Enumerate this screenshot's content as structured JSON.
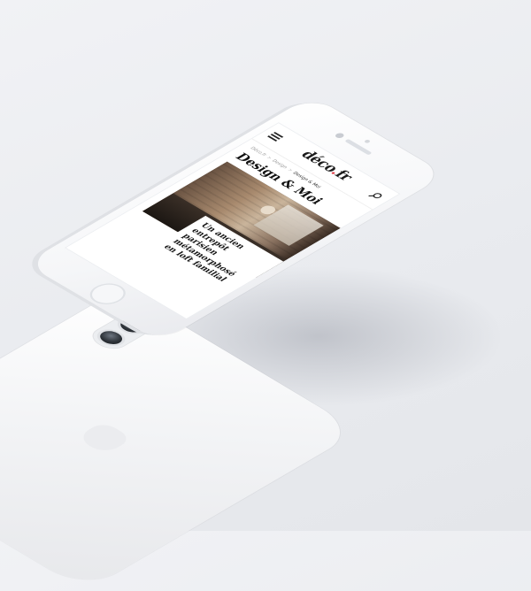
{
  "site": {
    "logo_text": "déco",
    "logo_dot": ".",
    "logo_suffix": "fr",
    "accent_color": "#e0343e"
  },
  "header": {
    "menu_icon": "hamburger-menu-icon",
    "search_icon": "search-icon"
  },
  "breadcrumb": {
    "items": [
      "Déco.fr",
      "Design",
      "Design & Moi"
    ],
    "separator": ">"
  },
  "page": {
    "title": "Design & Moi"
  },
  "article": {
    "title": "Un ancien entrepôt parisien métamorphosé en loft familial"
  }
}
